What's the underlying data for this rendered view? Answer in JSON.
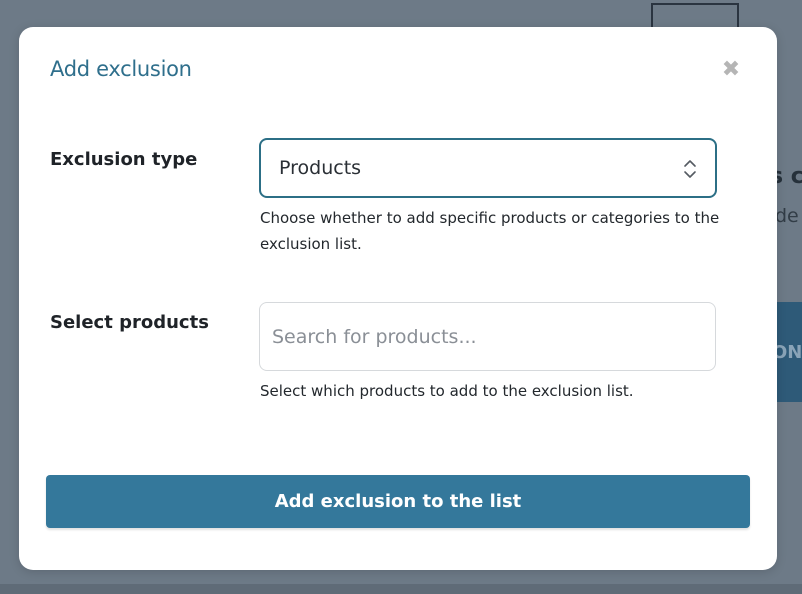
{
  "background": {
    "fragment_heading": "s c",
    "fragment_text": "de",
    "fragment_button": "ON"
  },
  "modal": {
    "title": "Add exclusion",
    "close_icon": "close-icon",
    "close_glyph": "✖",
    "exclusion_type": {
      "label": "Exclusion type",
      "selected_value": "Products",
      "help": "Choose whether to add specific products or categories to the exclusion list."
    },
    "select_products": {
      "label": "Select products",
      "placeholder": "Search for products...",
      "value": "",
      "help": "Select which products to add to the exclusion list."
    },
    "submit_label": "Add exclusion to the list"
  },
  "colors": {
    "accent": "#34789b",
    "title": "#2f6f8c",
    "overlay": "#6f7c89"
  }
}
